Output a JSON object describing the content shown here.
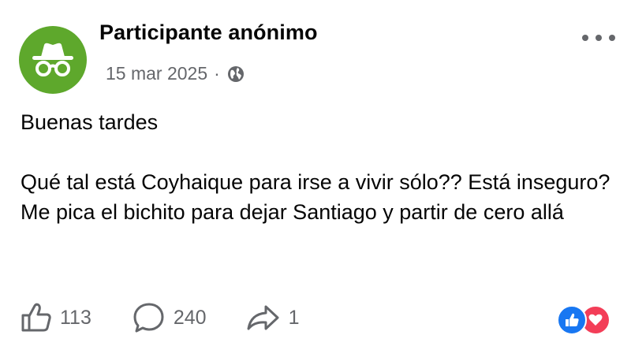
{
  "post": {
    "author": "Participante anónimo",
    "date": "15 mar 2025",
    "separator": "·",
    "privacy_icon": "globe-icon",
    "avatar_icon": "incognito-icon",
    "avatar_color": "#5ea82c",
    "body": {
      "greeting": "Buenas tardes",
      "message": "Qué tal está Coyhaique para irse a vivir sólo?? Está inseguro? Me pica el bichito para dejar Santiago y partir de cero allá"
    }
  },
  "actions": {
    "like_count": "113",
    "comment_count": "240",
    "share_count": "1"
  },
  "reactions": {
    "types": [
      "like",
      "love"
    ],
    "like_color": "#1877f2",
    "love_color": "#f33e58"
  },
  "colors": {
    "secondary_text": "#65676b",
    "primary_text": "#050505"
  }
}
